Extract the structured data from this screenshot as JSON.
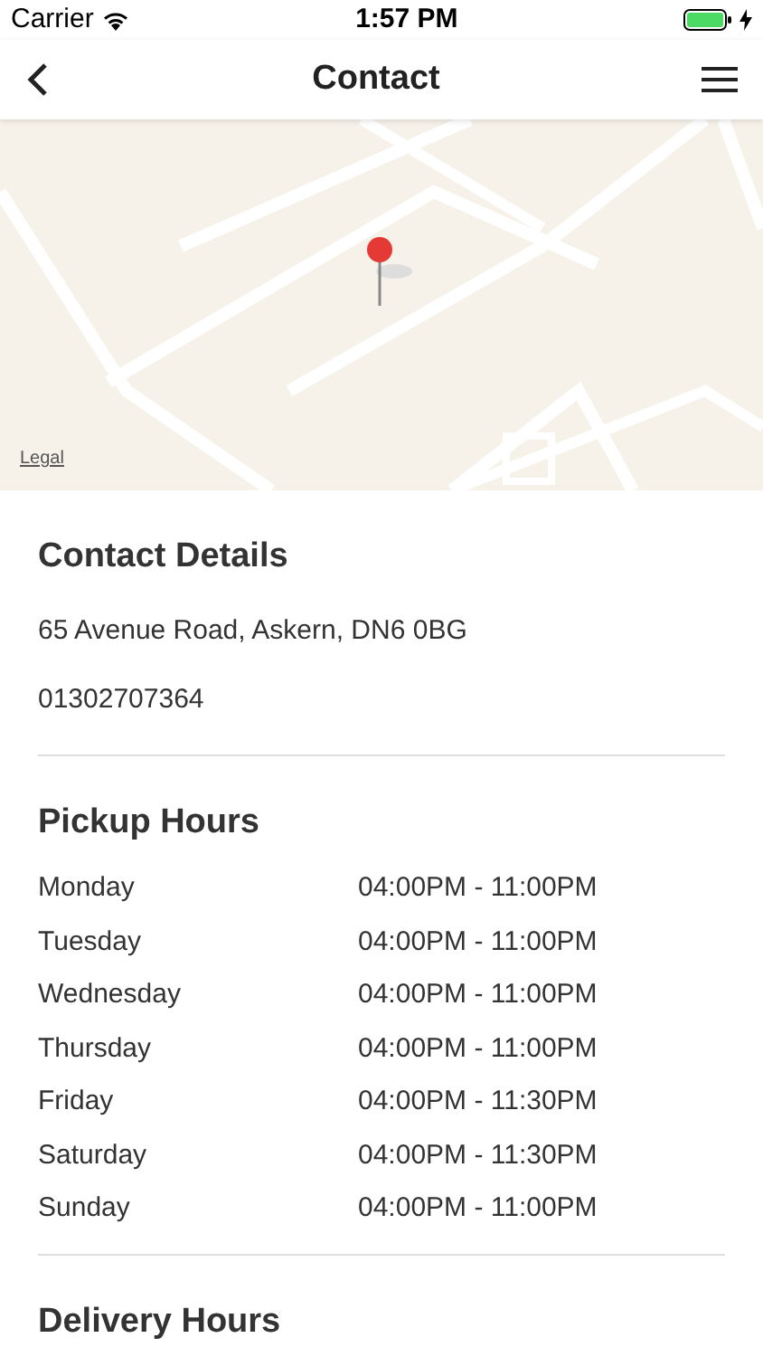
{
  "status_bar": {
    "carrier": "Carrier",
    "time": "1:57 PM"
  },
  "nav": {
    "title": "Contact"
  },
  "map": {
    "kind": "picture",
    "legal": "Legal"
  },
  "sections": [
    {
      "title": "Contact Details",
      "kind": "lines",
      "lines": [
        "65 Avenue Road, Askern, DN6 0BG",
        "01302707364"
      ]
    },
    {
      "title": "Pickup Hours",
      "kind": "hours",
      "rows": [
        {
          "day": "Monday",
          "hours": "04:00PM - 11:00PM"
        },
        {
          "day": "Tuesday",
          "hours": "04:00PM - 11:00PM"
        },
        {
          "day": "Wednesday",
          "hours": "04:00PM - 11:00PM"
        },
        {
          "day": "Thursday",
          "hours": "04:00PM - 11:00PM"
        },
        {
          "day": "Friday",
          "hours": "04:00PM - 11:30PM"
        },
        {
          "day": "Saturday",
          "hours": "04:00PM - 11:30PM"
        },
        {
          "day": "Sunday",
          "hours": "04:00PM - 11:00PM"
        }
      ]
    },
    {
      "title": "Delivery Hours",
      "kind": "hours"
    }
  ]
}
